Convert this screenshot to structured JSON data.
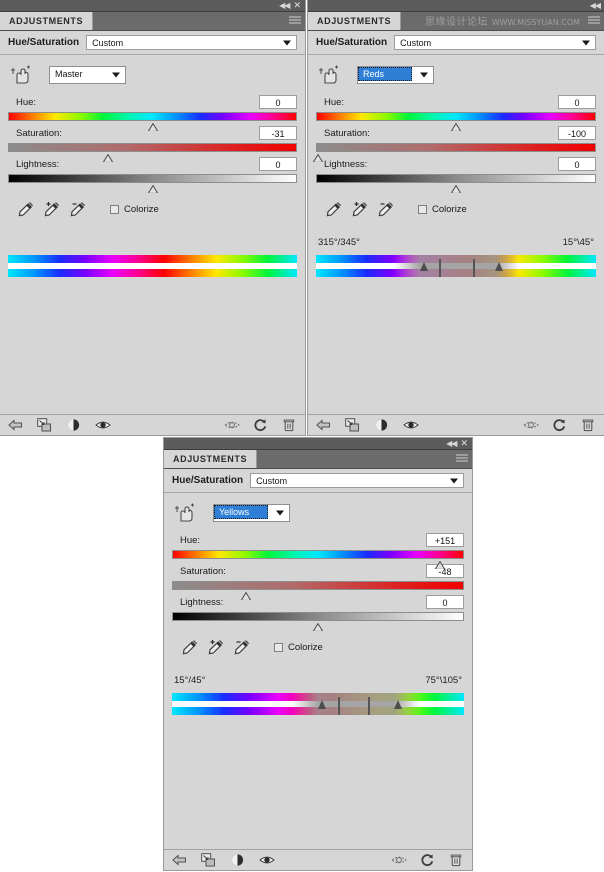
{
  "app": {
    "panel_tab_label": "ADJUSTMENTS",
    "adjustment_title": "Hue/Saturation",
    "watermark_cn": "思缘设计论坛",
    "watermark_en": "WWW.MISSYUAN.COM",
    "accent_selection_color": "#2f7fd6",
    "panel_bg_color": "#d6d6d6",
    "titlebar_color": "#5c5c5c"
  },
  "labels": {
    "hue": "Hue:",
    "saturation": "Saturation:",
    "lightness": "Lightness:",
    "colorize": "Colorize",
    "preset_value": "Custom"
  },
  "icons": {
    "collapse": "collapse-to-icons-icon",
    "close": "close-icon",
    "panel_menu": "panel-menu-icon",
    "targeted_adjustment": "targeted-adjustment-tool-icon",
    "eyedropper": "eyedropper-icon",
    "eyedropper_plus": "eyedropper-add-icon",
    "eyedropper_minus": "eyedropper-subtract-icon",
    "return_to_list": "return-to-adjustment-list-icon",
    "clip_to_layer": "clip-to-layer-icon",
    "toggle_mask": "toggle-layer-mask-icon",
    "toggle_visibility": "toggle-layer-visibility-icon",
    "view_previous": "view-previous-state-icon",
    "reset": "reset-icon",
    "delete": "delete-adjustment-icon"
  },
  "panels": [
    {
      "id": "panel-master",
      "channel": "Master",
      "channel_selected": false,
      "hue": "0",
      "saturation": "-31",
      "lightness": "0",
      "hue_thumb_pct": 50,
      "sat_thumb_pct": 34.5,
      "light_thumb_pct": 50,
      "colorize_checked": false,
      "range_visible": false,
      "range_left": "",
      "range_right": "",
      "range_markers": []
    },
    {
      "id": "panel-reds",
      "channel": "Reds",
      "channel_selected": true,
      "hue": "0",
      "saturation": "-100",
      "lightness": "0",
      "hue_thumb_pct": 50,
      "sat_thumb_pct": 0.5,
      "light_thumb_pct": 50,
      "colorize_checked": false,
      "range_visible": true,
      "range_left": "315°/345°",
      "range_right": "15°\\45°",
      "range_markers": [
        {
          "type": "tri",
          "pct": 37
        },
        {
          "type": "bar",
          "pct": 44
        },
        {
          "type": "bar",
          "pct": 56
        },
        {
          "type": "triR",
          "pct": 64
        }
      ],
      "range_band": {
        "start_pct": 37,
        "end_pct": 64
      }
    },
    {
      "id": "panel-yellows",
      "channel": "Yellows",
      "channel_selected": true,
      "hue": "+151",
      "saturation": "-48",
      "lightness": "0",
      "hue_thumb_pct": 92,
      "sat_thumb_pct": 25,
      "light_thumb_pct": 50,
      "colorize_checked": false,
      "range_visible": true,
      "range_left": "15°/45°",
      "range_right": "75°\\105°",
      "range_markers": [
        {
          "type": "tri",
          "pct": 50
        },
        {
          "type": "bar",
          "pct": 57
        },
        {
          "type": "bar",
          "pct": 67
        },
        {
          "type": "triR",
          "pct": 76
        }
      ],
      "range_band": {
        "start_pct": 50,
        "end_pct": 76
      }
    }
  ]
}
